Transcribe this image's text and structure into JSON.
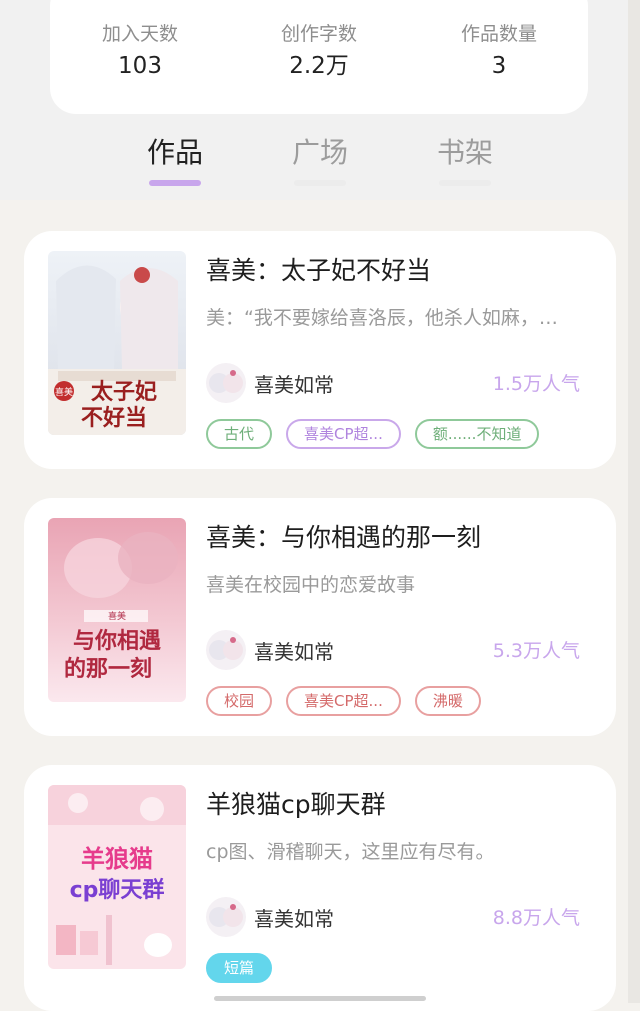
{
  "stats": [
    {
      "label": "加入天数",
      "value": "103"
    },
    {
      "label": "创作字数",
      "value": "2.2万"
    },
    {
      "label": "作品数量",
      "value": "3"
    }
  ],
  "tabs": [
    {
      "label": "作品",
      "active": true
    },
    {
      "label": "广场",
      "active": false
    },
    {
      "label": "书架",
      "active": false
    }
  ],
  "works": [
    {
      "title": "喜美：太子妃不好当",
      "description": "美：“我不要嫁给喜洛辰，他杀人如麻，…",
      "author": "喜美如常",
      "popularity": "1.5万人气",
      "cover_title": "太子妃不好当",
      "cover_series": "喜美",
      "tags": [
        {
          "text": "古代",
          "style": "green"
        },
        {
          "text": "喜美CP超...",
          "style": "purple"
        },
        {
          "text": "额......不知道",
          "style": "green"
        }
      ]
    },
    {
      "title": "喜美：与你相遇的那一刻",
      "description": "喜美在校园中的恋爱故事",
      "author": "喜美如常",
      "popularity": "5.3万人气",
      "cover_title": "与你相遇的那一刻",
      "cover_series": "喜美",
      "tags": [
        {
          "text": "校园",
          "style": "red"
        },
        {
          "text": "喜美CP超...",
          "style": "red"
        },
        {
          "text": "沸暖",
          "style": "red"
        }
      ]
    },
    {
      "title": "羊狼猫cp聊天群",
      "description": "cp图、滑稽聊天，这里应有尽有。",
      "author": "喜美如常",
      "popularity": "8.8万人气",
      "cover_title": "羊狼猫cp聊天群",
      "tags": [
        {
          "text": "短篇",
          "style": "cyan"
        }
      ]
    }
  ]
}
